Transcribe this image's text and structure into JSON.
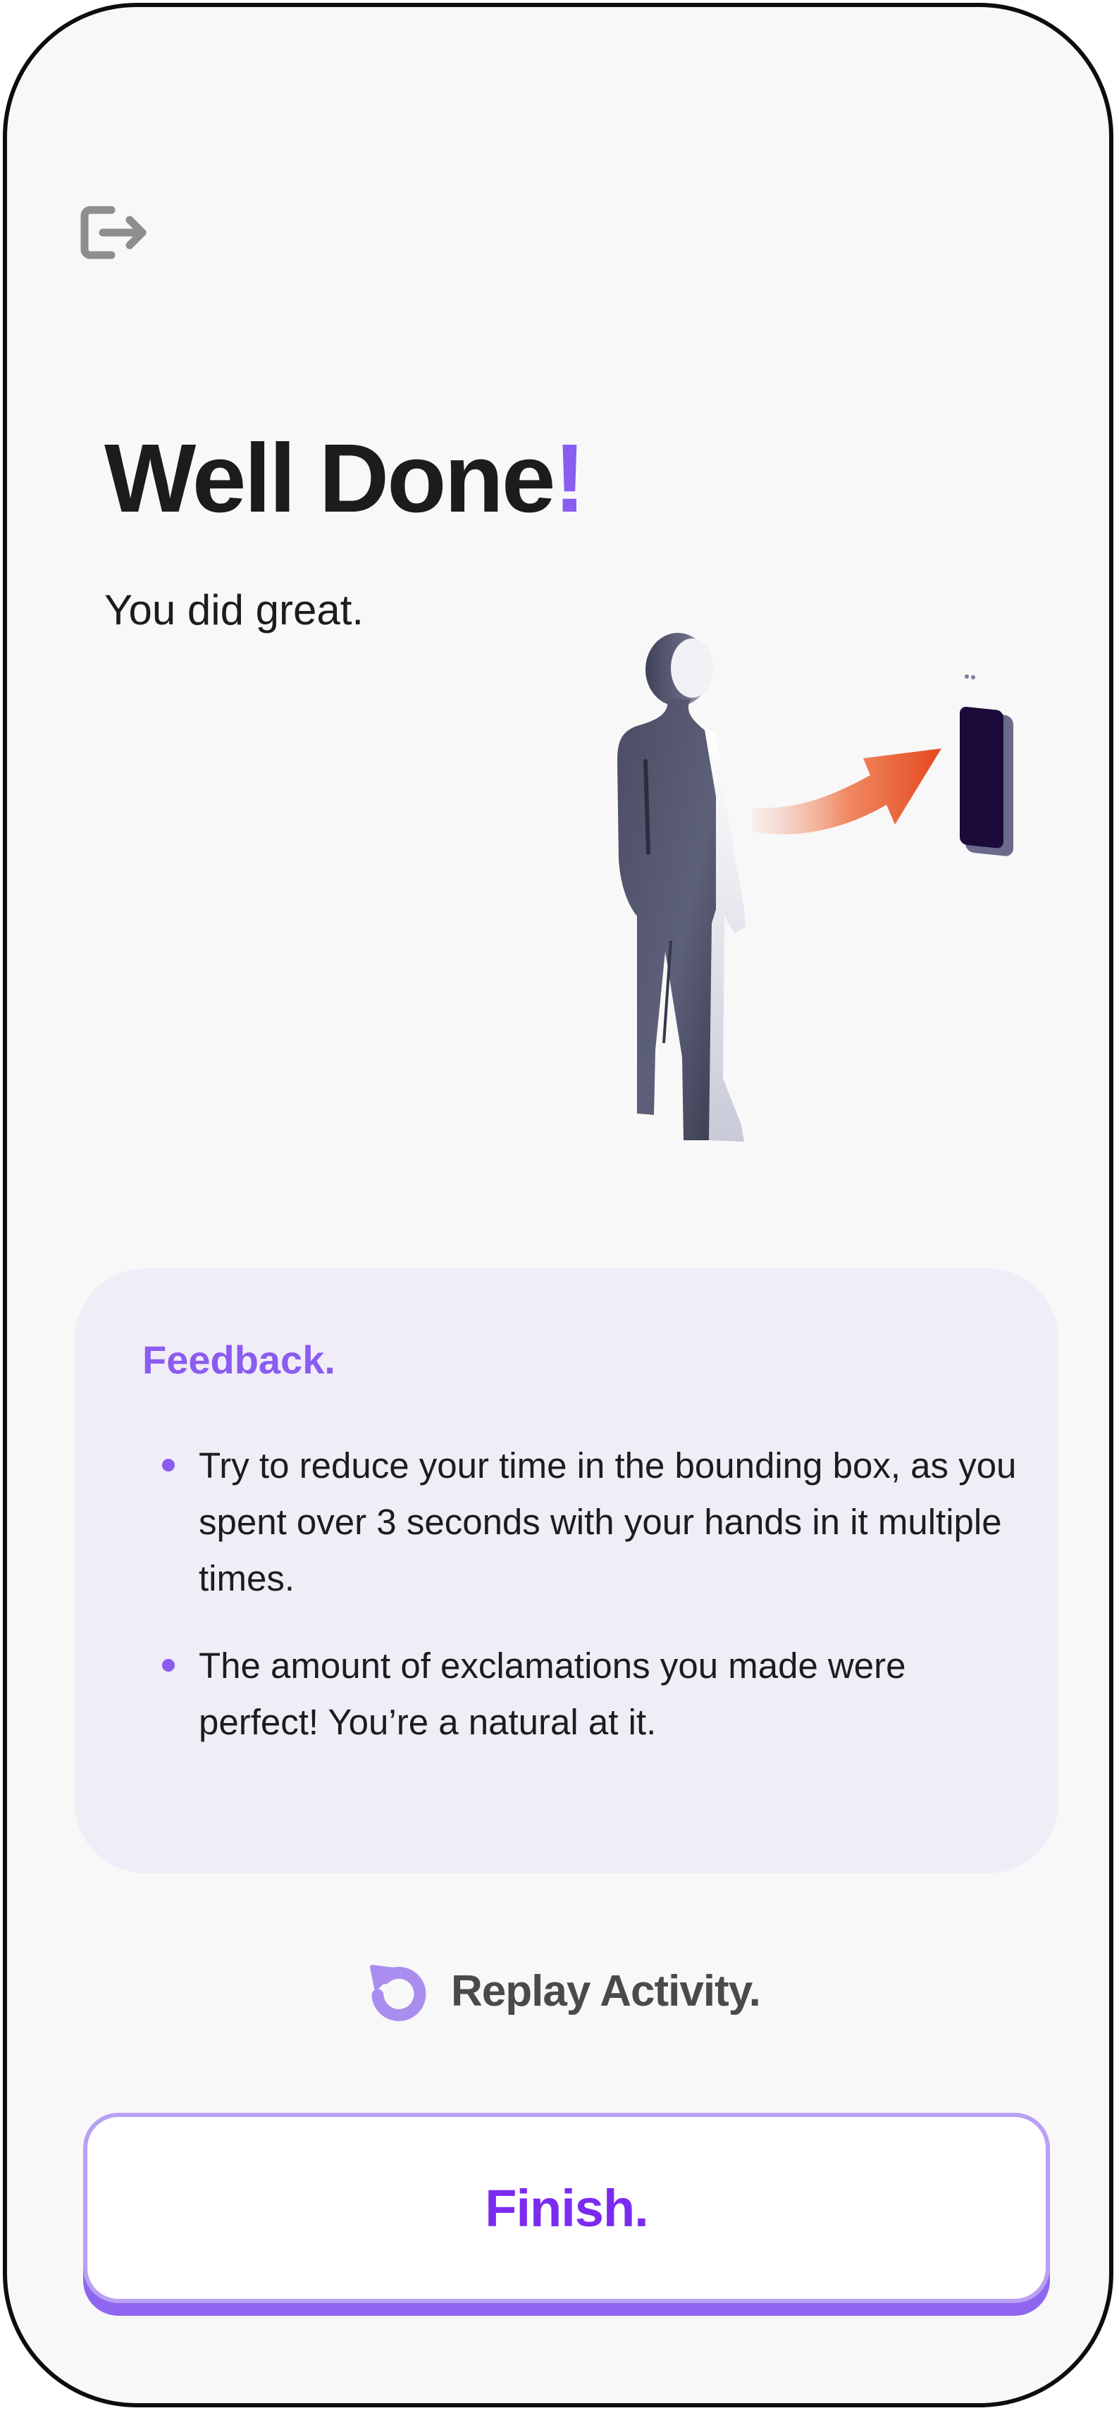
{
  "header": {
    "exit_icon": "exit-icon"
  },
  "hero": {
    "title": "Well Done",
    "title_mark": "!",
    "subtitle": "You did great."
  },
  "illustration": {
    "icon": "person-facing-phone-illustration"
  },
  "feedback": {
    "heading": "Feedback.",
    "items": [
      "Try to reduce your time in the bounding box, as you spent over 3 seconds with your hands in it multiple times.",
      "The amount of exclamations you made were perfect! You’re a natural at it."
    ]
  },
  "replay": {
    "label": "Replay Activity.",
    "icon": "replay-icon"
  },
  "finish": {
    "label": "Finish."
  },
  "colors": {
    "accent": "#8a5cf0",
    "finish_text": "#7b2bf0",
    "card_background": "#f0edf7",
    "page_background": "#f8f8f8"
  }
}
